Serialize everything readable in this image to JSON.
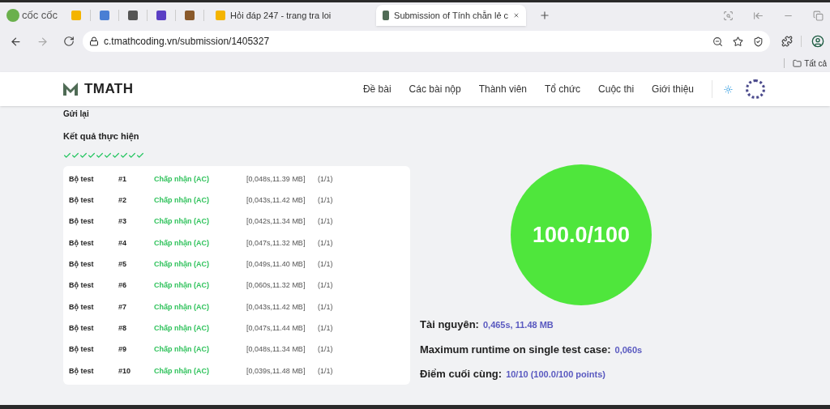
{
  "browser": {
    "brand": "cốc cốc",
    "tabs": [
      {
        "title": "Hỏi đáp 247 - trang tra loi",
        "selected": false
      },
      {
        "title": "Submission of Tính chẵn lẻ c",
        "selected": true
      }
    ],
    "url": "c.tmathcoding.vn/submission/1405327",
    "bookmarks_folder": "Tất cả"
  },
  "site": {
    "logo": "TMATH",
    "nav": [
      {
        "label": "Đề bài"
      },
      {
        "label": "Các bài nộp"
      },
      {
        "label": "Thành viên"
      },
      {
        "label": "Tổ chức"
      },
      {
        "label": "Cuộc thi"
      },
      {
        "label": "Giới thiệu"
      }
    ]
  },
  "resubmit": "Gửi lại",
  "results_title": "Kết quả thực hiện",
  "tests": [
    {
      "label": "Bộ test",
      "number": "#1",
      "status": "Chấp nhận (AC)",
      "passed": true,
      "resources": "[0,048s,11.39 MB]",
      "points": "(1/1)"
    },
    {
      "label": "Bộ test",
      "number": "#2",
      "status": "Chấp nhận (AC)",
      "passed": true,
      "resources": "[0,043s,11.42 MB]",
      "points": "(1/1)"
    },
    {
      "label": "Bộ test",
      "number": "#3",
      "status": "Chấp nhận (AC)",
      "passed": true,
      "resources": "[0,042s,11.34 MB]",
      "points": "(1/1)"
    },
    {
      "label": "Bộ test",
      "number": "#4",
      "status": "Chấp nhận (AC)",
      "passed": true,
      "resources": "[0,047s,11.32 MB]",
      "points": "(1/1)"
    },
    {
      "label": "Bộ test",
      "number": "#5",
      "status": "Chấp nhận (AC)",
      "passed": true,
      "resources": "[0,049s,11.40 MB]",
      "points": "(1/1)"
    },
    {
      "label": "Bộ test",
      "number": "#6",
      "status": "Chấp nhận (AC)",
      "passed": true,
      "resources": "[0,060s,11.32 MB]",
      "points": "(1/1)"
    },
    {
      "label": "Bộ test",
      "number": "#7",
      "status": "Chấp nhận (AC)",
      "passed": true,
      "resources": "[0,043s,11.42 MB]",
      "points": "(1/1)"
    },
    {
      "label": "Bộ test",
      "number": "#8",
      "status": "Chấp nhận (AC)",
      "passed": true,
      "resources": "[0,047s,11.44 MB]",
      "points": "(1/1)"
    },
    {
      "label": "Bộ test",
      "number": "#9",
      "status": "Chấp nhận (AC)",
      "passed": true,
      "resources": "[0,048s,11.34 MB]",
      "points": "(1/1)"
    },
    {
      "label": "Bộ test",
      "number": "#10",
      "status": "Chấp nhận (AC)",
      "passed": true,
      "resources": "[0,039s,11.48 MB]",
      "points": "(1/1)"
    }
  ],
  "score": "100.0/100",
  "summary": [
    {
      "label": "Tài nguyên:",
      "value": "0,465s, 11.48 MB"
    },
    {
      "label": "Maximum runtime on single test case:",
      "value": "0,060s"
    },
    {
      "label": "Điểm cuối cùng:",
      "value": "10/10 (100.0/100 points)"
    }
  ]
}
